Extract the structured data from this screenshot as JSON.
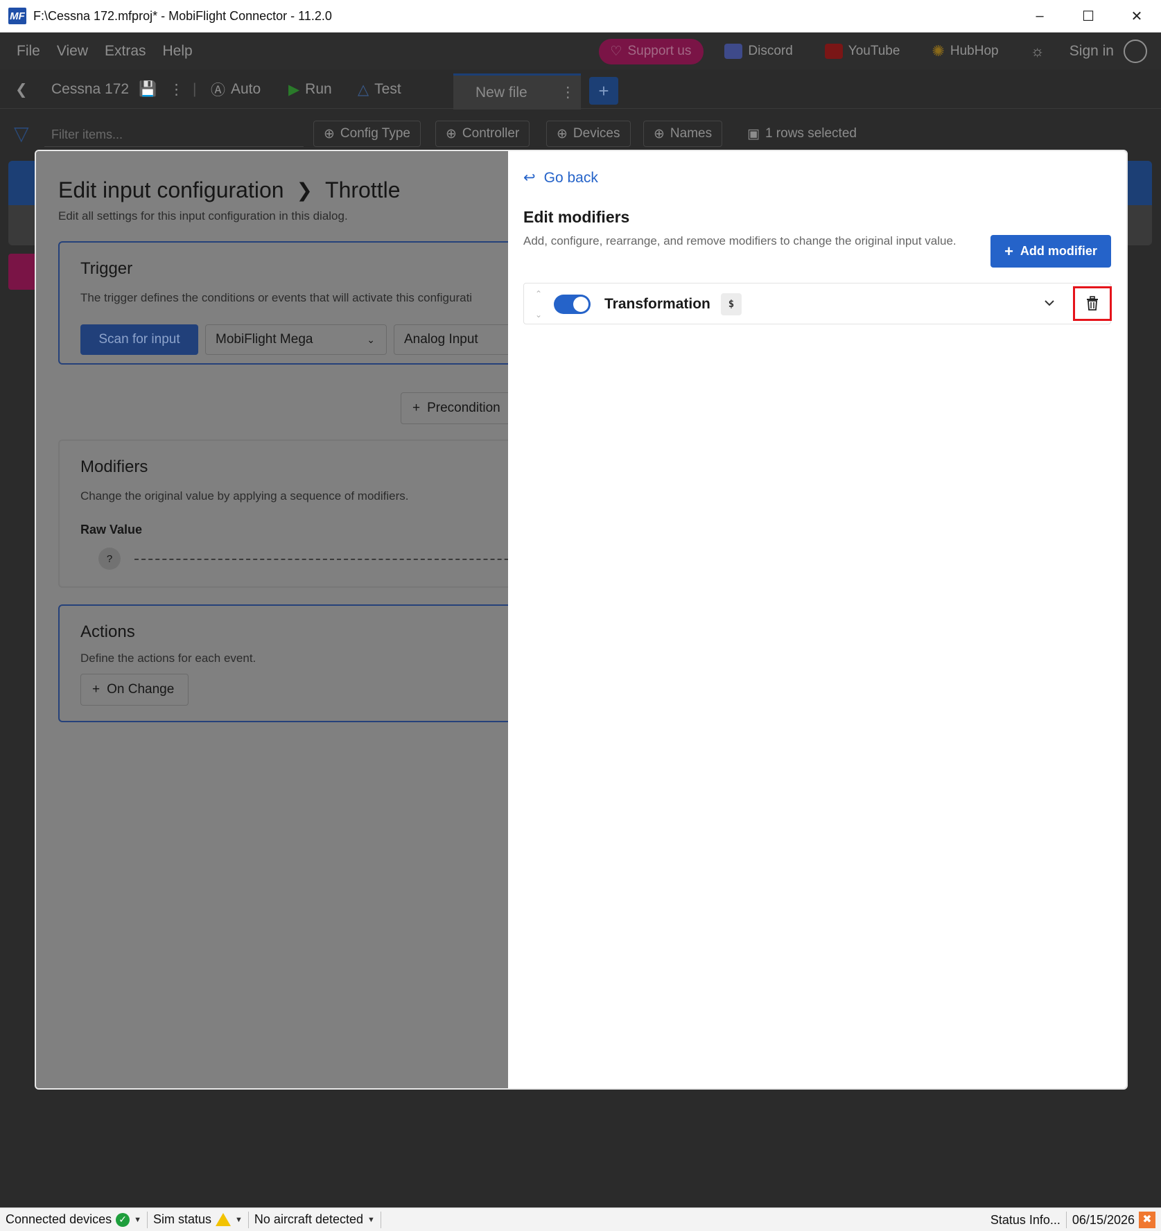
{
  "window": {
    "title": "F:\\Cessna 172.mfproj* - MobiFlight Connector - 11.2.0",
    "logo": "MF"
  },
  "menu": {
    "items": [
      "File",
      "View",
      "Extras",
      "Help"
    ],
    "support_label": "Support us",
    "discord_label": "Discord",
    "youtube_label": "YouTube",
    "hubhop_label": "HubHop",
    "signin_label": "Sign in"
  },
  "toolbar": {
    "project_name": "Cessna 172",
    "auto_label": "Auto",
    "run_label": "Run",
    "test_label": "Test",
    "tab_label": "New file",
    "add_tab": "+"
  },
  "filters": {
    "placeholder": "Filter items...",
    "chips": [
      "Config Type",
      "Controller",
      "Devices",
      "Names"
    ],
    "selection_label": "1 rows selected"
  },
  "dialog": {
    "breadcrumb_root": "Edit input configuration",
    "breadcrumb_current": "Throttle",
    "subtitle": "Edit all settings for this input configuration in this dialog.",
    "trigger": {
      "title": "Trigger",
      "description": "The trigger defines the conditions or events that will activate this configurati",
      "scan_label": "Scan for input",
      "device_select": "MobiFlight Mega",
      "input_select": "Analog Input"
    },
    "precondition_label": "Precondition",
    "modifiers": {
      "title": "Modifiers",
      "description": "Change the original value by applying a sequence of modifiers.",
      "raw_label": "Raw Value",
      "raw_value": "?"
    },
    "actions": {
      "title": "Actions",
      "description": "Define the actions for each event.",
      "on_change_label": "On Change"
    }
  },
  "editor": {
    "go_back_label": "Go back",
    "title": "Edit modifiers",
    "description": "Add, configure, rearrange, and remove modifiers to change the original input value.",
    "add_modifier_label": "Add modifier",
    "modifier": {
      "name": "Transformation",
      "badge": "$",
      "enabled": true
    }
  },
  "status": {
    "connected_devices": "Connected devices",
    "sim_status": "Sim status",
    "aircraft": "No aircraft detected",
    "status_info": "Status Info...",
    "date": "06/15/2026"
  },
  "colors": {
    "accent": "#2563c9",
    "highlight": "#e5141b",
    "support": "#7a1446"
  }
}
